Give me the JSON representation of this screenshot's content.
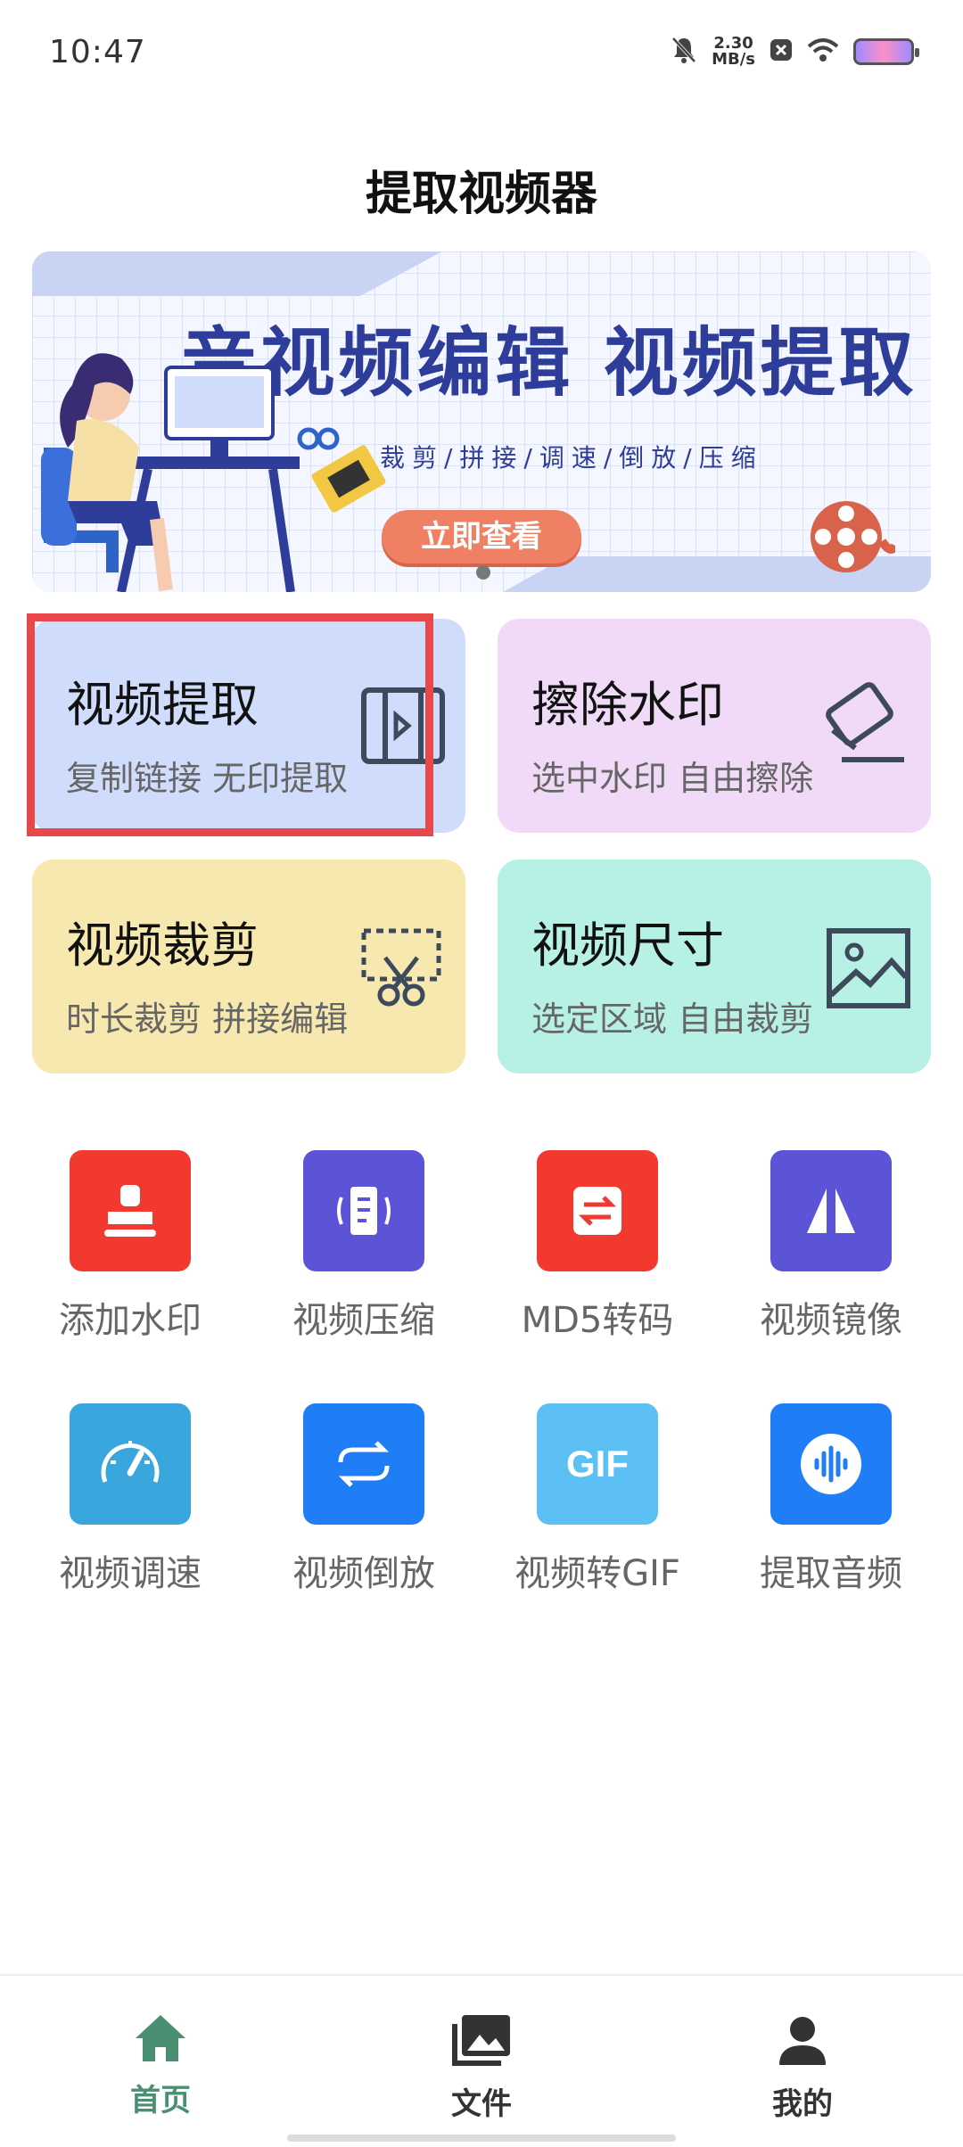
{
  "status_bar": {
    "time": "10:47",
    "net_speed_value": "2.30",
    "net_speed_unit": "MB/s",
    "icons": [
      "mute-bell-icon",
      "close-badge-icon",
      "wifi-icon",
      "battery-icon"
    ]
  },
  "header": {
    "title": "提取视频器"
  },
  "banner": {
    "headline": "音视频编辑  视频提取",
    "subtitle": "裁剪/拼接/调速/倒放/压缩",
    "button_label": "立即查看"
  },
  "feature_cards": [
    {
      "title": "视频提取",
      "subtitle": "复制链接 无印提取",
      "icon": "video-frame-icon",
      "bg": "#cfdcfb"
    },
    {
      "title": "擦除水印",
      "subtitle": "选中水印 自由擦除",
      "icon": "eraser-icon",
      "bg": "#f0daf8"
    },
    {
      "title": "视频裁剪",
      "subtitle": "时长裁剪 拼接编辑",
      "icon": "scissors-icon",
      "bg": "#f7e8b0"
    },
    {
      "title": "视频尺寸",
      "subtitle": "选定区域 自由裁剪",
      "icon": "image-frame-icon",
      "bg": "#b7f0e4"
    }
  ],
  "tools": [
    {
      "label": "添加水印",
      "icon": "stamp-icon",
      "color": "#f2392f"
    },
    {
      "label": "视频压缩",
      "icon": "compress-icon",
      "color": "#5b54d6"
    },
    {
      "label": "MD5转码",
      "icon": "transcode-icon",
      "color": "#f2392f"
    },
    {
      "label": "视频镜像",
      "icon": "mirror-icon",
      "color": "#5b54d6"
    },
    {
      "label": "视频调速",
      "icon": "speedometer-icon",
      "color": "#3aa6de"
    },
    {
      "label": "视频倒放",
      "icon": "loop-icon",
      "color": "#1f7ef5"
    },
    {
      "label": "视频转GIF",
      "icon": "gif-icon",
      "color": "#5cc0f5"
    },
    {
      "label": "提取音频",
      "icon": "audio-wave-icon",
      "color": "#1f7ef5"
    }
  ],
  "gif_text": "GIF",
  "bottom_nav": [
    {
      "label": "首页",
      "icon": "home-icon",
      "active": true,
      "color": "#4a8f72"
    },
    {
      "label": "文件",
      "icon": "gallery-icon",
      "active": false,
      "color": "#333333"
    },
    {
      "label": "我的",
      "icon": "person-icon",
      "active": false,
      "color": "#333333"
    }
  ]
}
